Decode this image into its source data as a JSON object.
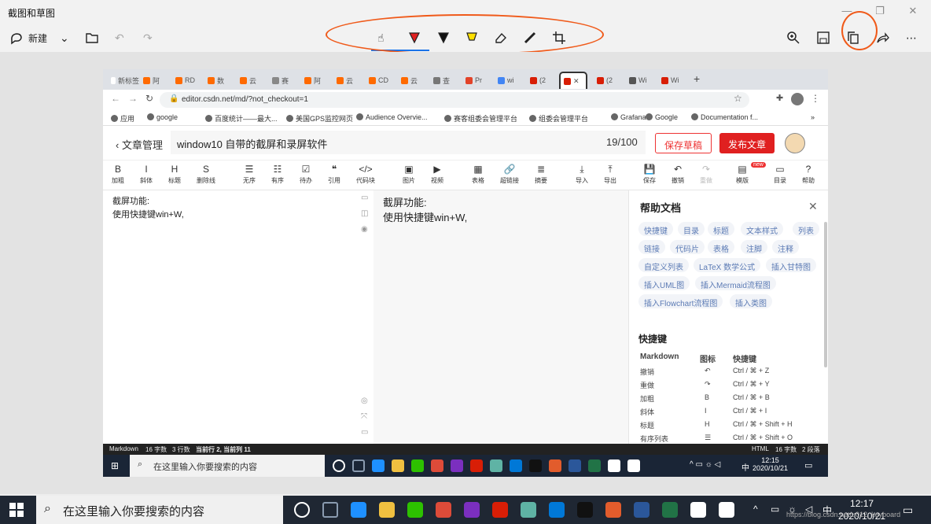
{
  "app": {
    "title": "截图和草图",
    "new_label": "新建"
  },
  "browser": {
    "tabs": [
      {
        "label": "新标签",
        "color": "#ffffff"
      },
      {
        "label": "阿",
        "color": "#ff6a00"
      },
      {
        "label": "RD",
        "color": "#ff6a00"
      },
      {
        "label": "数",
        "color": "#ff6a00"
      },
      {
        "label": "云",
        "color": "#ff6a00"
      },
      {
        "label": "赛",
        "color": "#888888"
      },
      {
        "label": "阿",
        "color": "#ff6a00"
      },
      {
        "label": "云",
        "color": "#ff6a00"
      },
      {
        "label": "CD",
        "color": "#ff6a00"
      },
      {
        "label": "云",
        "color": "#ff6a00"
      },
      {
        "label": "查",
        "color": "#777777"
      },
      {
        "label": "Pr",
        "color": "#e24329"
      },
      {
        "label": "wi",
        "color": "#4285f4"
      },
      {
        "label": "(2",
        "color": "#d81e06"
      },
      {
        "label": "",
        "color": "#d81e06"
      },
      {
        "label": "(2",
        "color": "#d81e06"
      },
      {
        "label": "Wi",
        "color": "#555555"
      },
      {
        "label": "Wi",
        "color": "#d81e06"
      }
    ],
    "url": "editor.csdn.net/md/?not_checkout=1",
    "bookmarks": [
      "应用",
      "google",
      "百度统计——最大...",
      "美国GPS监控网页",
      "Audience Overvie...",
      "赛客组委会管理平台",
      "组委会管理平台",
      "Grafana",
      "Google",
      "Documentation f..."
    ],
    "bookmarks_more": "»"
  },
  "editor": {
    "back_label": "文章管理",
    "title": "window10 自带的截屏和录屏软件",
    "count": "19/100",
    "save_draft": "保存草稿",
    "publish": "发布文章",
    "toolbar": [
      {
        "icon": "B",
        "label": "加粗"
      },
      {
        "icon": "I",
        "label": "斜体"
      },
      {
        "icon": "H",
        "label": "标题"
      },
      {
        "icon": "S",
        "label": "删除线"
      },
      {
        "icon": "☰",
        "label": "无序"
      },
      {
        "icon": "☷",
        "label": "有序"
      },
      {
        "icon": "☑",
        "label": "待办"
      },
      {
        "icon": "❝",
        "label": "引用"
      },
      {
        "icon": "</>",
        "label": "代码块"
      },
      {
        "icon": "▣",
        "label": "图片"
      },
      {
        "icon": "▶",
        "label": "视频"
      },
      {
        "icon": "▦",
        "label": "表格"
      },
      {
        "icon": "🔗",
        "label": "超链接"
      },
      {
        "icon": "≣",
        "label": "摘要"
      },
      {
        "icon": "⤓",
        "label": "导入"
      },
      {
        "icon": "⤒",
        "label": "导出"
      },
      {
        "icon": "💾",
        "label": "保存"
      },
      {
        "icon": "↶",
        "label": "撤销"
      },
      {
        "icon": "↷",
        "label": "重做"
      },
      {
        "icon": "▤",
        "label": "模版"
      },
      {
        "icon": "▭",
        "label": "目录"
      },
      {
        "icon": "?",
        "label": "帮助"
      }
    ],
    "new_badge": "new",
    "content_lines": [
      "截屏功能:",
      "使用快捷键win+W,"
    ],
    "help": {
      "title": "帮助文档",
      "chips": [
        "快捷键",
        "目录",
        "标题",
        "文本样式",
        "列表",
        "链接",
        "代码片",
        "表格",
        "注脚",
        "注释",
        "自定义列表",
        "LaTeX 数学公式",
        "插入甘特图",
        "插入UML图",
        "插入Mermaid流程图",
        "插入Flowchart流程图",
        "插入类图"
      ],
      "shortcuts_title": "快捷键",
      "columns": [
        "Markdown",
        "图标",
        "快捷键"
      ],
      "rows": [
        [
          "撤销",
          "↶",
          "Ctrl / ⌘ + Z"
        ],
        [
          "重做",
          "↷",
          "Ctrl / ⌘ + Y"
        ],
        [
          "加粗",
          "B",
          "Ctrl / ⌘ + B"
        ],
        [
          "斜体",
          "I",
          "Ctrl / ⌘ + I"
        ],
        [
          "标题",
          "H",
          "Ctrl / ⌘ + Shift + H"
        ],
        [
          "有序列表",
          "☰",
          "Ctrl / ⌘ + Shift + O"
        ]
      ]
    },
    "status": {
      "left": [
        "Markdown",
        "16 字数",
        "3 行数",
        "当前行 2, 当前列 11"
      ],
      "right": [
        "HTML",
        "16 字数",
        "2 段落"
      ]
    }
  },
  "inner_taskbar": {
    "search_placeholder": "在这里输入你要搜索的内容",
    "time": "12:15",
    "date": "2020/10/21",
    "ime": "中"
  },
  "taskbar": {
    "search_placeholder": "在这里输入你要搜索的内容",
    "time": "12:17",
    "date": "2020/10/21",
    "ime": "中",
    "watermark": "https://blog.csdn.net/u012_keyboard"
  },
  "colors": {
    "accent": "#1a73e8",
    "annotation": "#f05a1a",
    "csdn_red": "#e02020"
  }
}
